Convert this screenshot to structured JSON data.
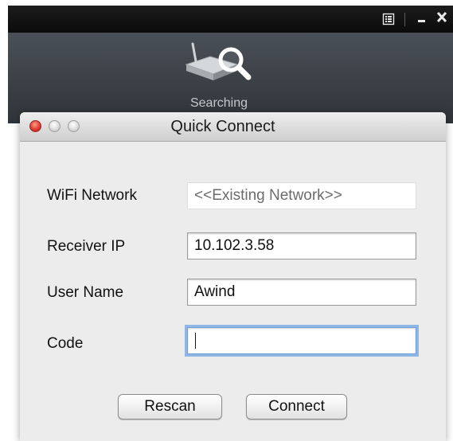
{
  "background_app": {
    "status_label": "Searching",
    "titlebar": {
      "menu_icon": "list-menu-icon",
      "minimize_icon": "minimize-icon",
      "close_icon": "close-icon"
    },
    "toolbar_icon": "receiver-search-icon"
  },
  "dialog": {
    "title": "Quick Connect",
    "window_controls": [
      "close-button",
      "minimize-button",
      "zoom-button"
    ],
    "fields": {
      "wifi": {
        "label": "WiFi Network",
        "value": "<<Existing Network>>"
      },
      "receiver_ip": {
        "label": "Receiver IP",
        "value": "10.102.3.58"
      },
      "user_name": {
        "label": "User Name",
        "value": "Awind"
      },
      "code": {
        "label": "Code",
        "value": ""
      }
    },
    "buttons": {
      "rescan": "Rescan",
      "connect": "Connect"
    }
  },
  "colors": {
    "app_background": "#3c4248",
    "titlebar": "#111111",
    "dialog_background": "#ececec",
    "focus_ring": "#8fb7e6",
    "close_red": "#d9362b"
  }
}
